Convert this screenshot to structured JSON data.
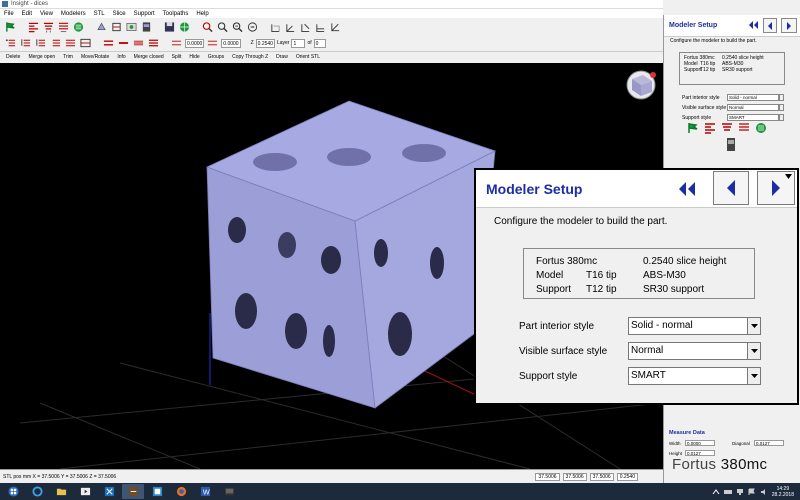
{
  "window": {
    "title": "Insight - dices"
  },
  "menu": [
    "File",
    "Edit",
    "View",
    "Modelers",
    "STL",
    "Slice",
    "Support",
    "Toolpaths",
    "Help"
  ],
  "toolbar": {
    "field1": "0.0000",
    "field2": "0.0000",
    "z_label": "Z",
    "z_value": "0.2540",
    "layer_label": "Layer",
    "layer_value": "1",
    "layer_of": "of",
    "layer_total": "0"
  },
  "commands": [
    "Delete",
    "Merge open",
    "Trim",
    "Move/Rotate",
    "Info",
    "Merge closed",
    "Split",
    "Hide",
    "Groups",
    "Copy Through Z",
    "Draw",
    "Orient STL"
  ],
  "status": {
    "text": "STL pos mm  X = 37.5006  Y = 37.5006  Z = 37.5006",
    "box1": "37.5006",
    "box2": "37.5006",
    "box3": "37.5006",
    "z_box": "0.2540"
  },
  "panel": {
    "title": "Modeler Setup",
    "subtitle": "Configure the modeler to build the part.",
    "info": {
      "row1_col1": "Fortus 380mc",
      "row1_col3": "0.2540 slice height",
      "row2_col1": "Model",
      "row2_col2": "T16 tip",
      "row2_col3": "ABS-M30",
      "row3_col1": "Support",
      "row3_col2": "T12 tip",
      "row3_col3": "SR30 support"
    },
    "fields": {
      "part_interior_label": "Part interior style",
      "part_interior_value": "Solid - normal",
      "visible_surface_label": "Visible surface style",
      "visible_surface_value": "Normal",
      "support_style_label": "Support style",
      "support_style_value": "SMART"
    }
  },
  "measure": {
    "title": "Measure Data",
    "width_label": "Width",
    "width_value": "0.0000",
    "diagonal_label": "Diagonal",
    "diagonal_value": "0.0127",
    "height_label": "Height",
    "height_value": "0.0127"
  },
  "brand": {
    "name": "Fortus",
    "model": "380mc"
  },
  "tray": {
    "time": "14:29",
    "date": "28.2.2018"
  },
  "colors": {
    "title_blue": "#1c2da6",
    "cube": "#9c9ed8",
    "viewport": "#000000"
  }
}
